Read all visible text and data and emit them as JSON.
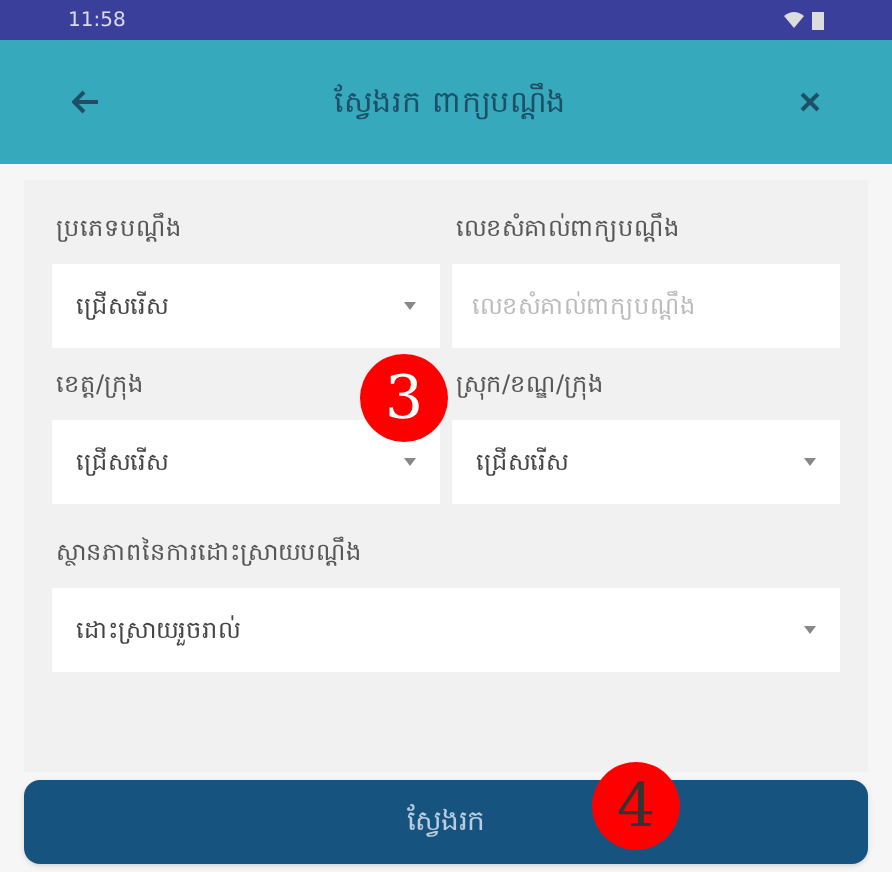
{
  "status_bar": {
    "time": "11:58"
  },
  "header": {
    "title": "ស្វែងរក ពាក្យបណ្តឹង"
  },
  "fields": [
    {
      "label": "ប្រភេទបណ្តឹង",
      "kind": "dropdown",
      "value": "ជ្រើសរើស"
    },
    {
      "label": "លេខសំគាល់ពាក្យបណ្តឹង",
      "kind": "text",
      "placeholder": "លេខសំគាល់ពាក្យបណ្តឹង"
    },
    {
      "label": "ខេត្ត/ក្រុង",
      "kind": "dropdown",
      "value": "ជ្រើសរើស"
    },
    {
      "label": "ស្រុក/ខណ្ឌ/ក្រុង",
      "kind": "dropdown",
      "value": "ជ្រើសរើស"
    },
    {
      "label": "ស្ថានភាពនៃការដោះស្រាយបណ្តឹង",
      "kind": "dropdown",
      "value": "ដោះស្រាយរួចរាល់"
    }
  ],
  "search_button": "ស្វែងរក",
  "annotations": [
    "3",
    "4"
  ]
}
